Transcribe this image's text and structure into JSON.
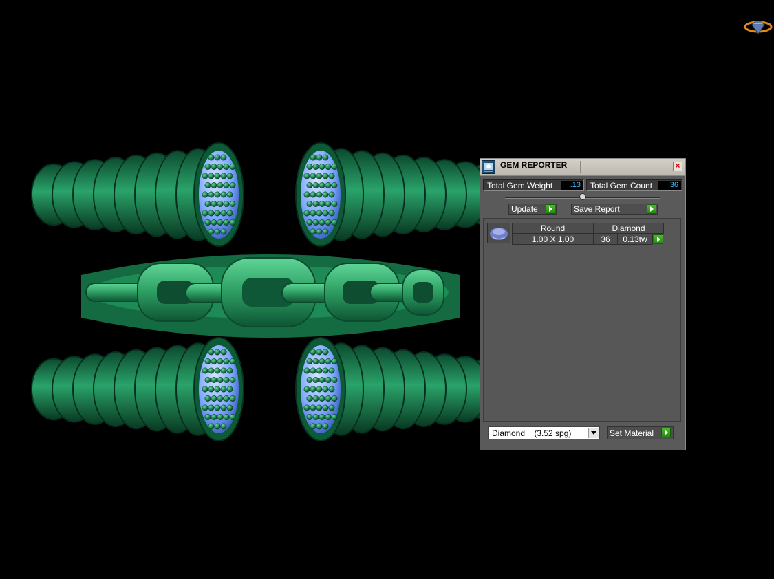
{
  "panel": {
    "title": "GEM REPORTER",
    "total_weight_label": "Total Gem Weight",
    "total_weight_value": ".13",
    "total_count_label": "Total Gem Count",
    "total_count_value": "36",
    "update_label": "Update",
    "save_report_label": "Save Report",
    "gem_rows": [
      {
        "shape": "Round",
        "size": "1.00 X 1.00",
        "material": "Diamond",
        "count": "36",
        "weight": "0.13tw"
      }
    ],
    "material_selected": "Diamond    (3.52 spg)",
    "set_material_label": "Set Material"
  },
  "icons": {
    "title": "gem-reporter-icon",
    "close": "close-icon",
    "logo": "navigation-gem-logo",
    "go": "green-play-icon"
  },
  "colors": {
    "model_green": "#1f8b55",
    "gem_blue": "#7fa8ff",
    "value_cyan": "#3ec0ff",
    "go_green": "#3aa020"
  }
}
